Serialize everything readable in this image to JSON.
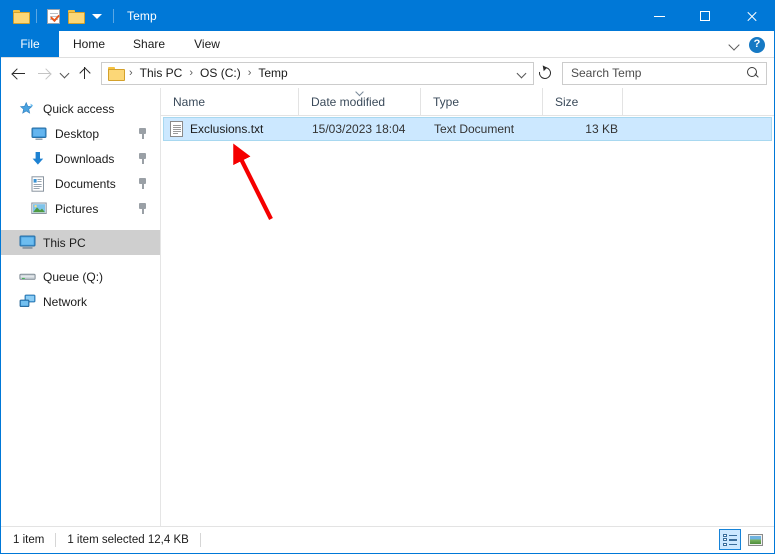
{
  "window": {
    "title": "Temp",
    "quick_access_toolbar": [
      {
        "name": "folder-icon",
        "label": "Folder"
      },
      {
        "name": "properties-icon",
        "label": "Properties"
      },
      {
        "name": "new-folder-icon",
        "label": "New folder"
      },
      {
        "name": "customize-caret-icon",
        "label": "Customize Quick Access Toolbar"
      }
    ],
    "controls": {
      "minimize": "Minimize",
      "maximize": "Maximize",
      "close": "Close"
    }
  },
  "ribbon": {
    "tabs": [
      {
        "label": "File",
        "active": true
      },
      {
        "label": "Home",
        "active": false
      },
      {
        "label": "Share",
        "active": false
      },
      {
        "label": "View",
        "active": false
      }
    ],
    "expand_label": "Expand the Ribbon",
    "help_label": "?"
  },
  "address_bar": {
    "back_label": "Back",
    "forward_label": "Forward",
    "recent_label": "Recent locations",
    "up_label": "Up",
    "breadcrumbs": [
      "This PC",
      "OS (C:)",
      "Temp"
    ],
    "separator": "›",
    "dropdown_label": "Previous locations",
    "refresh_label": "Refresh"
  },
  "search": {
    "placeholder": "Search Temp",
    "value": ""
  },
  "sidebar": {
    "items": [
      {
        "label": "Quick access",
        "icon": "star-icon",
        "indent": false,
        "pinned": false,
        "selected": false
      },
      {
        "label": "Desktop",
        "icon": "desktop-icon",
        "indent": true,
        "pinned": true,
        "selected": false
      },
      {
        "label": "Downloads",
        "icon": "downloads-icon",
        "indent": true,
        "pinned": true,
        "selected": false
      },
      {
        "label": "Documents",
        "icon": "documents-icon",
        "indent": true,
        "pinned": true,
        "selected": false
      },
      {
        "label": "Pictures",
        "icon": "pictures-icon",
        "indent": true,
        "pinned": true,
        "selected": false
      },
      {
        "label": "This PC",
        "icon": "this-pc-icon",
        "indent": false,
        "pinned": false,
        "selected": true
      },
      {
        "label": "Queue (Q:)",
        "icon": "drive-icon",
        "indent": false,
        "pinned": false,
        "selected": false
      },
      {
        "label": "Network",
        "icon": "network-icon",
        "indent": false,
        "pinned": false,
        "selected": false
      }
    ]
  },
  "file_list": {
    "columns": [
      {
        "label": "Name",
        "sorted": false
      },
      {
        "label": "Date modified",
        "sorted": true
      },
      {
        "label": "Type",
        "sorted": false
      },
      {
        "label": "Size",
        "sorted": false
      }
    ],
    "rows": [
      {
        "name": "Exclusions.txt",
        "date_modified": "15/03/2023 18:04",
        "type": "Text Document",
        "size": "13 KB",
        "icon": "text-document-icon",
        "selected": true
      }
    ]
  },
  "status_bar": {
    "item_count": "1 item",
    "selection": "1 item selected  12,4 KB",
    "views": [
      {
        "name": "details-view-button",
        "label": "Details view",
        "active": true
      },
      {
        "name": "large-icons-view-button",
        "label": "Large icons view",
        "active": false
      }
    ]
  },
  "annotation": {
    "arrow_color": "#f50000",
    "arrow_label": "red-arrow-pointing-to-file"
  },
  "colors": {
    "accent": "#0078d7",
    "selection": "#cce8ff",
    "sidebar_selected": "#cfcfcf",
    "arrow": "#f50000"
  }
}
